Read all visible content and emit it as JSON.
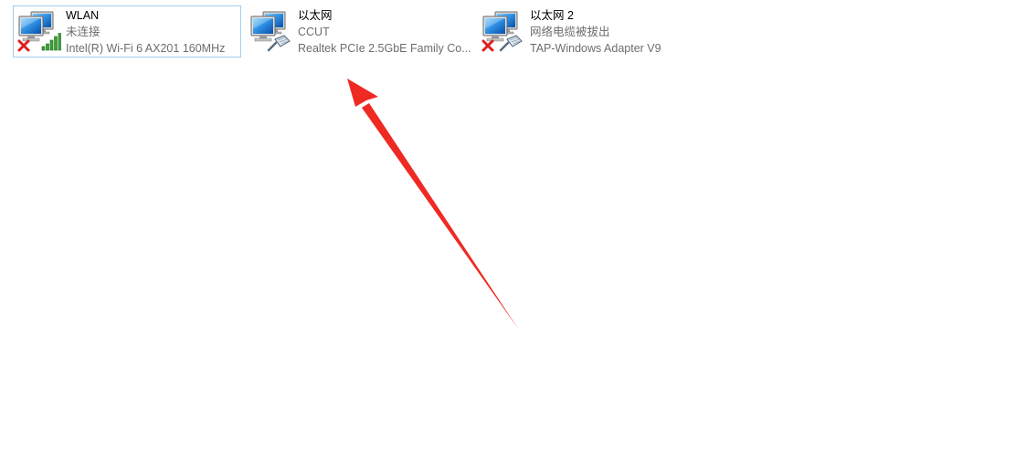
{
  "adapters": [
    {
      "id": "wlan",
      "name": "WLAN",
      "status": "未连接",
      "device": "Intel(R) Wi-Fi 6 AX201 160MHz",
      "selected": true,
      "overlay_icons": [
        "red-x-icon",
        "wifi-signal-bars-icon"
      ]
    },
    {
      "id": "ethernet",
      "name": "以太网",
      "status": "CCUT",
      "device": "Realtek PCIe 2.5GbE Family Co...",
      "selected": false,
      "overlay_icons": [
        "network-cable-icon"
      ]
    },
    {
      "id": "ethernet2",
      "name": "以太网 2",
      "status": "网络电缆被拔出",
      "device": "TAP-Windows Adapter V9",
      "selected": false,
      "overlay_icons": [
        "red-x-icon",
        "network-cable-icon"
      ]
    }
  ],
  "colors": {
    "selection_border": "#9fcdf1",
    "status_text": "#6d6d6d",
    "annotation_arrow": "#ee2a23",
    "error_x": "#d92020",
    "wifi_green": "#3aa136"
  }
}
